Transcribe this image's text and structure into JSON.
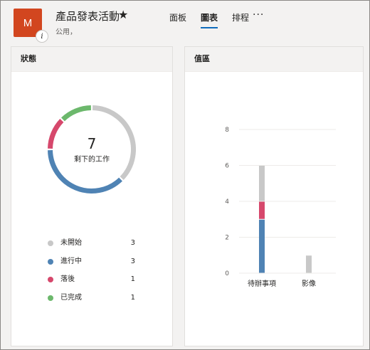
{
  "header": {
    "avatar_initial": "M",
    "info_glyph": "i",
    "title": "產品發表活動",
    "star": "★",
    "subtitle": "公用，",
    "tabs": [
      {
        "label": "面板",
        "active": false
      },
      {
        "label": "圖表",
        "active": true
      },
      {
        "label": "排程",
        "active": false
      }
    ],
    "more": "···"
  },
  "status_card": {
    "title": "狀態",
    "center_value": "7",
    "center_label": "剩下的工作",
    "legend": [
      {
        "label": "未開始",
        "count": "3",
        "color": "#c8c8c8"
      },
      {
        "label": "進行中",
        "count": "3",
        "color": "#4f83b4"
      },
      {
        "label": "落後",
        "count": "1",
        "color": "#d6486c"
      },
      {
        "label": "已完成",
        "count": "1",
        "color": "#6cb86c"
      }
    ]
  },
  "bucket_card": {
    "title": "值區"
  },
  "chart_data": [
    {
      "type": "pie",
      "title": "",
      "variant": "donut",
      "categories": [
        "未開始",
        "進行中",
        "落後",
        "已完成"
      ],
      "values": [
        3,
        3,
        1,
        1
      ],
      "colors": [
        "#c8c8c8",
        "#4f83b4",
        "#d6486c",
        "#6cb86c"
      ]
    },
    {
      "type": "bar",
      "stacked": true,
      "categories": [
        "待辦事項",
        "影像"
      ],
      "series": [
        {
          "values": [
            3,
            0
          ],
          "color": "#4f83b4"
        },
        {
          "values": [
            1,
            0
          ],
          "color": "#d6486c"
        },
        {
          "values": [
            2,
            1
          ],
          "color": "#c8c8c8"
        }
      ],
      "yticks": [
        0,
        2,
        4,
        6,
        8
      ],
      "ylim": [
        0,
        8
      ],
      "grid": true
    }
  ]
}
